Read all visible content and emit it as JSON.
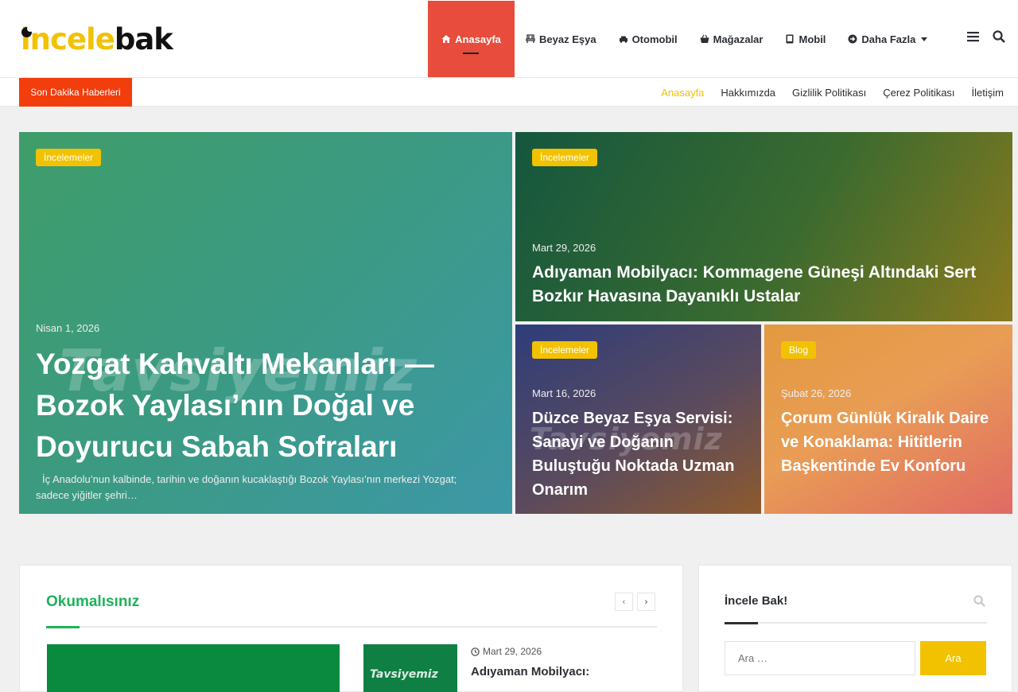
{
  "brand": {
    "logo_part1": "incele",
    "logo_part2": "bak",
    "accent": "#f2c200",
    "nav_active": "#e74c3c"
  },
  "nav": {
    "items": [
      {
        "label": "Anasayfa",
        "icon": "home-icon"
      },
      {
        "label": "Beyaz Eşya",
        "icon": "chair-icon"
      },
      {
        "label": "Otomobil",
        "icon": "car-icon"
      },
      {
        "label": "Mağazalar",
        "icon": "basket-icon"
      },
      {
        "label": "Mobil",
        "icon": "tablet-icon"
      },
      {
        "label": "Daha Fazla",
        "icon": "arrow-circle-icon"
      }
    ]
  },
  "topbar": {
    "breaking": "Son Dakika Haberleri",
    "links": [
      "Anasayfa",
      "Hakkımızda",
      "Gizlilik Politikası",
      "Çerez Politikası",
      "İletişim"
    ]
  },
  "featured": [
    {
      "badge": "İncelemeler",
      "date": "Nisan 1, 2026",
      "title": "Yozgat Kahvaltı Mekanları — Bozok Yaylası’nın Doğal ve Doyurucu Sabah Sofraları",
      "excerpt": "İç Anadolu’nun kalbinde, tarihin ve doğanın kucaklaştığı Bozok Yaylası’nın merkezi Yozgat; sadece yiğitler şehri…"
    },
    {
      "badge": "İncelemeler",
      "date": "Mart 29, 2026",
      "title": "Adıyaman Mobilyacı: Kommagene Güneşi Altındaki Sert Bozkır Havasına Dayanıklı Ustalar"
    },
    {
      "badge": "İncelemeler",
      "date": "Mart 16, 2026",
      "title": "Düzce Beyaz Eşya Servisi: Sanayi ve Doğanın Buluştuğu Noktada Uzman Onarım"
    },
    {
      "badge": "Blog",
      "date": "Şubat 26, 2026",
      "title": "Çorum Günlük Kiralık Daire ve Konaklama: Hititlerin Başkentinde Ev Konforu"
    }
  ],
  "watermark": "Tavsiyemiz",
  "reads": {
    "title": "Okumalısınız",
    "prev": "‹",
    "next": "›",
    "item": {
      "date": "Mart 29, 2026",
      "title": "Adıyaman Mobilyacı:"
    }
  },
  "sidebar": {
    "title": "İncele Bak!",
    "search_placeholder": "Ara …",
    "search_button": "Ara"
  }
}
